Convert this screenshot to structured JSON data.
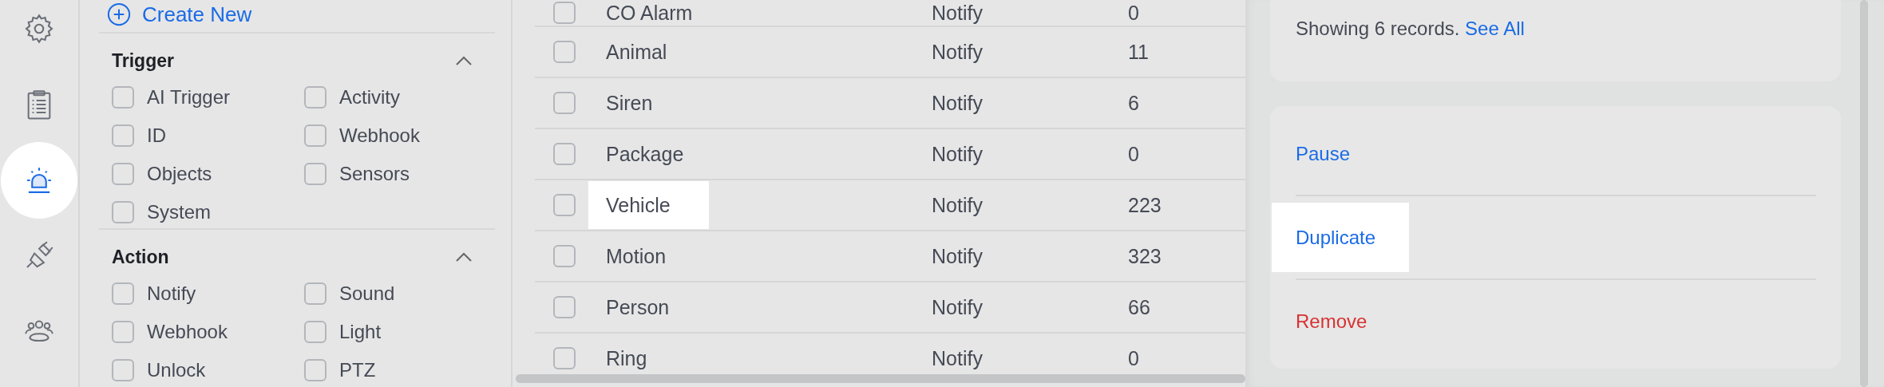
{
  "rail": [
    {
      "kind": "gear",
      "selected": false
    },
    {
      "kind": "clipboard",
      "selected": false
    },
    {
      "kind": "siren",
      "selected": true
    },
    {
      "kind": "plug",
      "selected": false
    },
    {
      "kind": "people",
      "selected": false
    }
  ],
  "filters": {
    "create_new": "Create New",
    "sections": [
      {
        "title": "Trigger",
        "expanded": true,
        "options": [
          {
            "label": "AI Trigger",
            "checked": false
          },
          {
            "label": "Activity",
            "checked": false
          },
          {
            "label": "ID",
            "checked": false
          },
          {
            "label": "Webhook",
            "checked": false
          },
          {
            "label": "Objects",
            "checked": false
          },
          {
            "label": "Sensors",
            "checked": false
          },
          {
            "label": "System",
            "checked": false
          }
        ]
      },
      {
        "title": "Action",
        "expanded": true,
        "options": [
          {
            "label": "Notify",
            "checked": false
          },
          {
            "label": "Sound",
            "checked": false
          },
          {
            "label": "Webhook",
            "checked": false
          },
          {
            "label": "Light",
            "checked": false
          },
          {
            "label": "Unlock",
            "checked": false
          },
          {
            "label": "PTZ",
            "checked": false
          }
        ]
      }
    ]
  },
  "table": {
    "rows": [
      {
        "name": "CO Alarm",
        "action": "Notify",
        "count": "0",
        "checked": false,
        "highlighted": false
      },
      {
        "name": "Animal",
        "action": "Notify",
        "count": "11",
        "checked": false,
        "highlighted": false
      },
      {
        "name": "Siren",
        "action": "Notify",
        "count": "6",
        "checked": false,
        "highlighted": false
      },
      {
        "name": "Package",
        "action": "Notify",
        "count": "0",
        "checked": false,
        "highlighted": false
      },
      {
        "name": "Vehicle",
        "action": "Notify",
        "count": "223",
        "checked": false,
        "highlighted": true
      },
      {
        "name": "Motion",
        "action": "Notify",
        "count": "323",
        "checked": false,
        "highlighted": false
      },
      {
        "name": "Person",
        "action": "Notify",
        "count": "66",
        "checked": false,
        "highlighted": false
      },
      {
        "name": "Ring",
        "action": "Notify",
        "count": "0",
        "checked": false,
        "highlighted": false
      }
    ]
  },
  "summary": {
    "text": "Showing 6 records.",
    "link": "See All"
  },
  "actions": [
    {
      "label": "Pause",
      "kind": "normal",
      "highlighted": false
    },
    {
      "label": "Duplicate",
      "kind": "normal",
      "highlighted": true
    },
    {
      "label": "Remove",
      "kind": "danger",
      "highlighted": false
    }
  ]
}
